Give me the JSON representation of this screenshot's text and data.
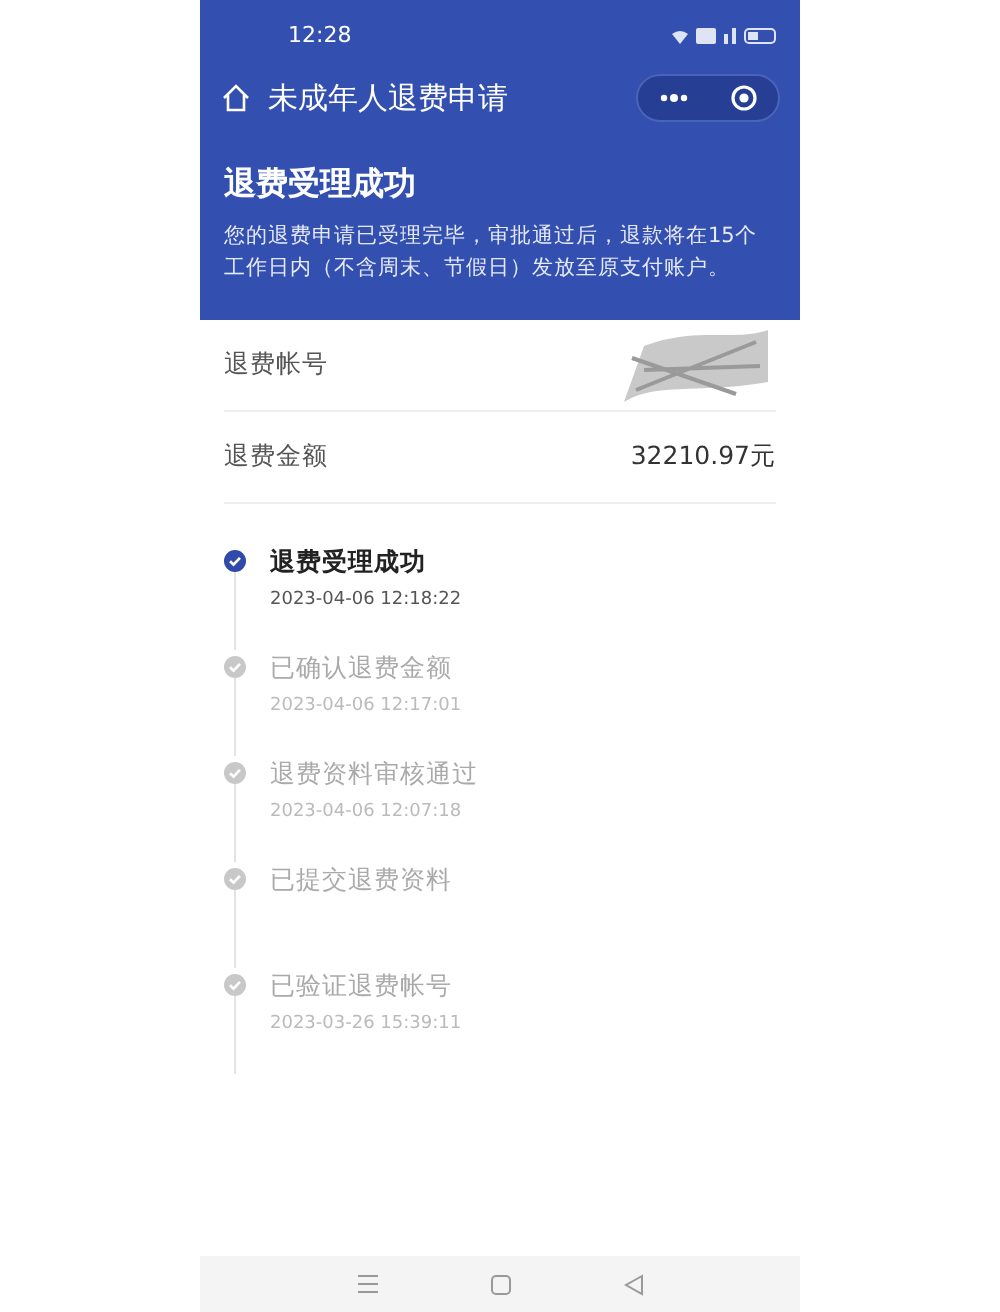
{
  "status_bar": {
    "time": "12:28"
  },
  "nav": {
    "title": "未成年人退费申请"
  },
  "banner": {
    "title": "退费受理成功",
    "description": "您的退费申请已受理完毕，审批通过后，退款将在15个工作日内（不含周末、节假日）发放至原支付账户。"
  },
  "fields": [
    {
      "label": "退费帐号"
    },
    {
      "label": "退费金额",
      "value": "32210.97元"
    }
  ],
  "timeline": [
    {
      "title": "退费受理成功",
      "time": "2023-04-06 12:18:22",
      "current": true
    },
    {
      "title": "已确认退费金额",
      "time": "2023-04-06 12:17:01",
      "current": false
    },
    {
      "title": "退费资料审核通过",
      "time": "2023-04-06 12:07:18",
      "current": false
    },
    {
      "title": "已提交退费资料",
      "current": false
    },
    {
      "title": "已验证退费帐号",
      "time": "2023-03-26 15:39:11",
      "current": false
    }
  ]
}
